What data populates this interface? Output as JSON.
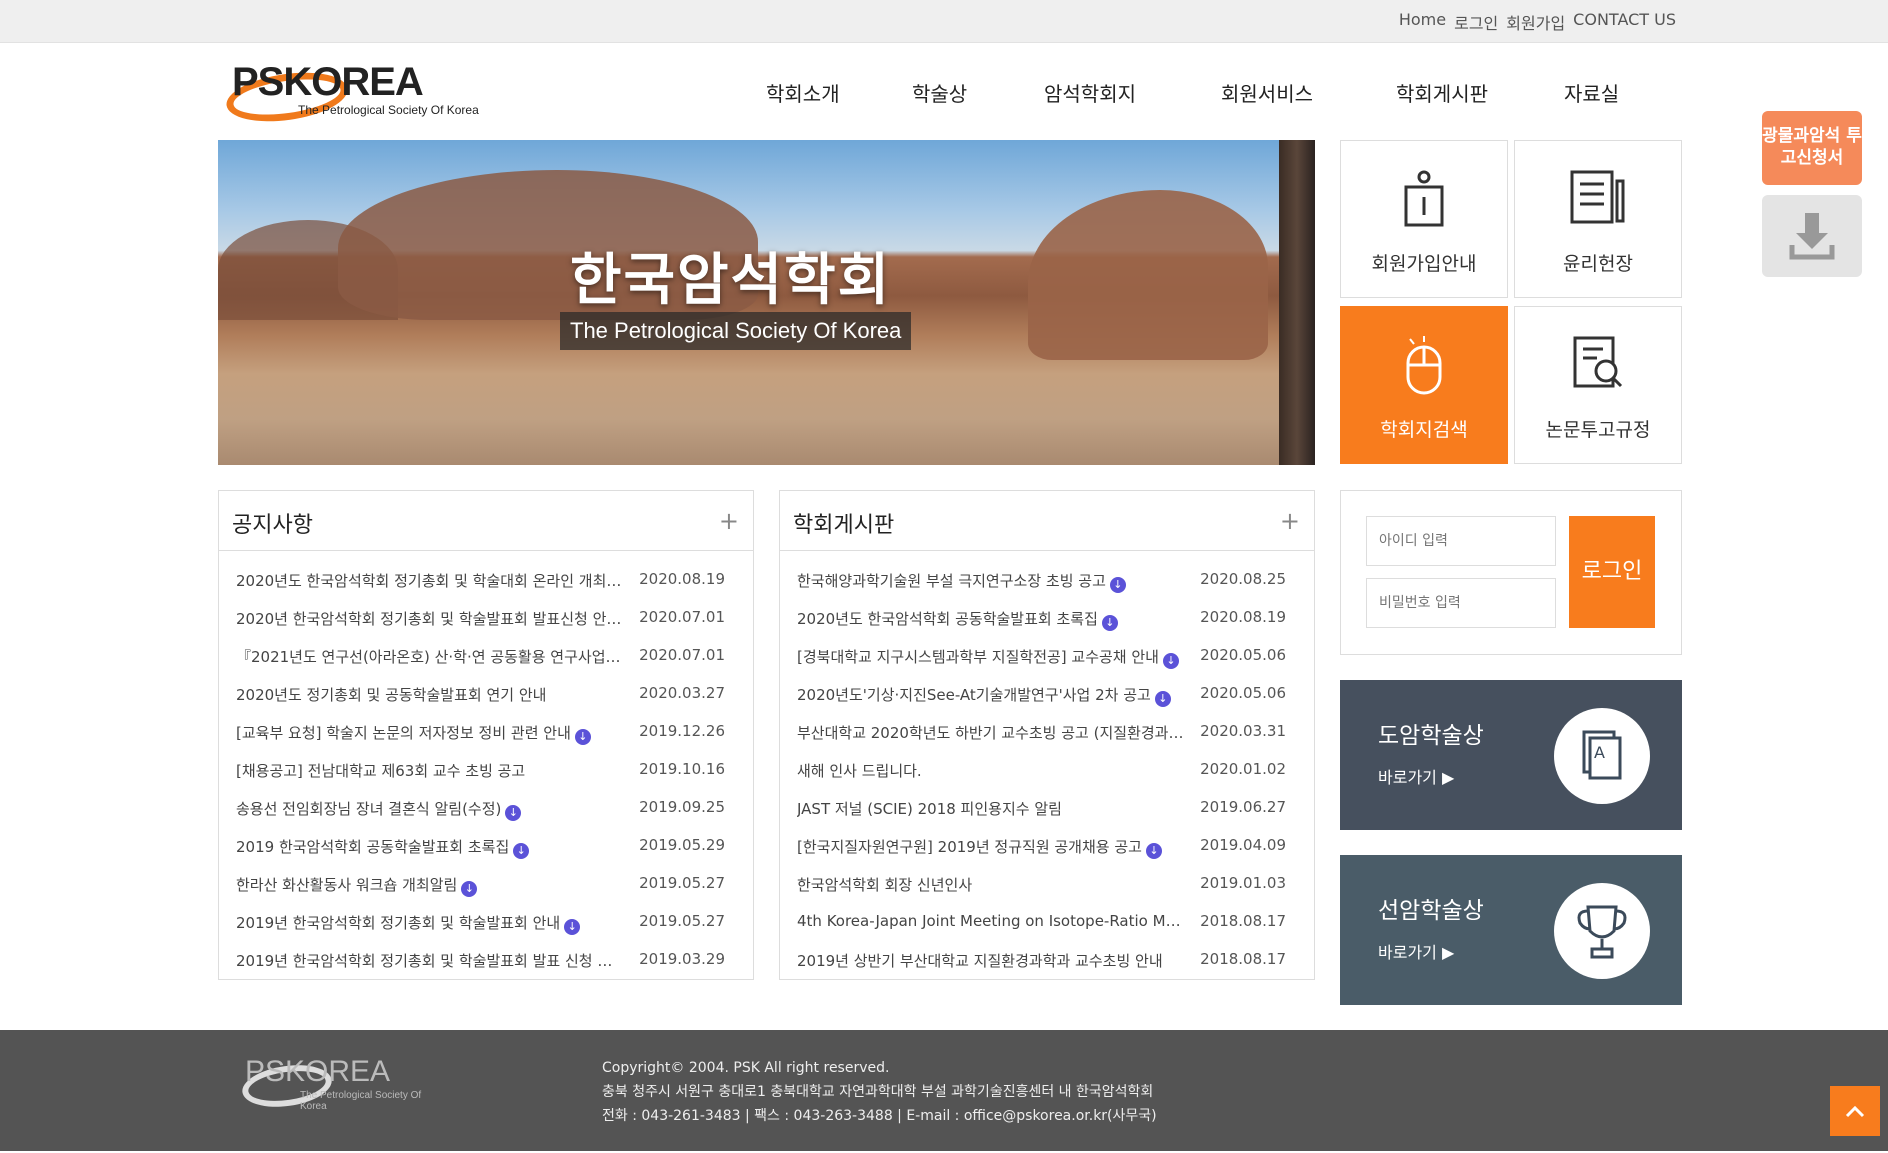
{
  "topbar": {
    "home": "Home",
    "login": "로그인",
    "join": "회원가입",
    "contact": "CONTACT US"
  },
  "logo": {
    "word": "PSKOREA",
    "sub": "The Petrological Society Of Korea"
  },
  "nav": [
    "학회소개",
    "학술상",
    "암석학회지",
    "회원서비스",
    "학회게시판",
    "자료실"
  ],
  "hero": {
    "title": "한국암석학회",
    "caption": "The Petrological Society Of Korea"
  },
  "tiles": [
    "회원가입안내",
    "윤리헌장",
    "학회지검색",
    "논문투고규정"
  ],
  "side": {
    "apply": "광물과암석 투고신청서"
  },
  "notice": {
    "title": "공지사항",
    "items": [
      {
        "t": "2020년도 한국암석학회 정기총회 및 학술대회 온라인 개최 …",
        "d": "2020.08.19"
      },
      {
        "t": "2020년 한국암석학회 정기총회 및 학술발표회 발표신청 안내…",
        "d": "2020.07.01"
      },
      {
        "t": "『2021년도 연구선(아라온호) 산·학·연 공동활용 연구사업』…",
        "d": "2020.07.01"
      },
      {
        "t": "2020년도 정기총회 및 공동학술발표회 연기 안내",
        "d": "2020.03.27"
      },
      {
        "t": "[교육부 요청] 학술지 논문의 저자정보 정비 관련 안내",
        "d": "2019.12.26",
        "dl": true
      },
      {
        "t": "[채용공고] 전남대학교 제63회 교수 초빙 공고",
        "d": "2019.10.16"
      },
      {
        "t": "송용선 전임회장님 장녀 결혼식 알림(수정)",
        "d": "2019.09.25",
        "dl": true
      },
      {
        "t": "2019 한국암석학회 공동학술발표회 초록집",
        "d": "2019.05.29",
        "dl": true
      },
      {
        "t": "한라산 화산활동사 워크숍 개최알림",
        "d": "2019.05.27",
        "dl": true
      },
      {
        "t": "2019년 한국암석학회 정기총회 및 학술발표회 안내",
        "d": "2019.05.27",
        "dl": true
      },
      {
        "t": "2019년 한국암석학회 정기총회 및 학술발표회 발표 신청 안…",
        "d": "2019.03.29"
      }
    ]
  },
  "board": {
    "title": "학회게시판",
    "items": [
      {
        "t": "한국해양과학기술원 부설 극지연구소장 초빙 공고",
        "d": "2020.08.25",
        "dl": true
      },
      {
        "t": "2020년도 한국암석학회 공동학술발표회 초록집",
        "d": "2020.08.19",
        "dl": true
      },
      {
        "t": "[경북대학교 지구시스템과학부 지질학전공] 교수공채 안내",
        "d": "2020.05.06",
        "dl": true
      },
      {
        "t": "2020년도'기상·지진See-At기술개발연구'사업 2차 공고",
        "d": "2020.05.06",
        "dl": true
      },
      {
        "t": "부산대학교 2020학년도 하반기 교수초빙 공고 (지질환경과…",
        "d": "2020.03.31"
      },
      {
        "t": "새해 인사 드립니다.",
        "d": "2020.01.02"
      },
      {
        "t": "JAST 저널 (SCIE) 2018 피인용지수 알림",
        "d": "2019.06.27"
      },
      {
        "t": "[한국지질자원연구원] 2019년 정규직원 공개채용 공고",
        "d": "2019.04.09",
        "dl": true
      },
      {
        "t": "한국암석학회 회장 신년인사",
        "d": "2019.01.03"
      },
      {
        "t": "4th Korea-Japan Joint Meeting on Isotope-Ratio Mass …",
        "d": "2018.08.17"
      },
      {
        "t": "2019년 상반기 부산대학교 지질환경과학과 교수초빙 안내",
        "d": "2018.08.17"
      }
    ]
  },
  "login": {
    "id_placeholder": "아이디 입력",
    "pw_placeholder": "비밀번호 입력",
    "button": "로그인"
  },
  "awards": [
    {
      "title": "도암학술상",
      "go": "바로가기 ▶"
    },
    {
      "title": "선암학술상",
      "go": "바로가기 ▶"
    }
  ],
  "footer": {
    "copyright": "Copyright© 2004. PSK All right reserved.",
    "address": "충북 청주시 서원구 충대로1 충북대학교 자연과학대학 부설 과학기술진흥센터 내 한국암석학회",
    "contact": "전화 : 043-261-3483 | 팩스 : 043-263-3488 | E-mail : office@pskorea.or.kr(사무국)"
  },
  "colors": {
    "accent": "#f87c1d",
    "award_dark": "#46505e",
    "download": "#5b52d8"
  }
}
